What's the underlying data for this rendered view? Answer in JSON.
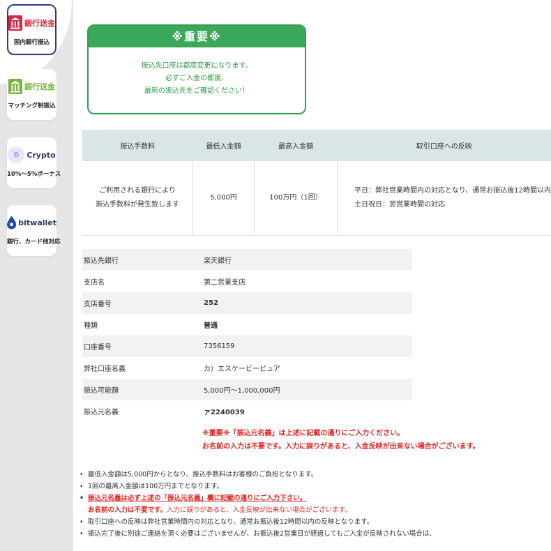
{
  "sidebar": {
    "tabs": [
      {
        "title": "銀行送金",
        "subtitle": "国内銀行振込",
        "active": true,
        "color": "#d7263d",
        "icon": "bank-icon"
      },
      {
        "title": "銀行送金",
        "subtitle": "マッチング制振込",
        "active": false,
        "color": "#7ab33d",
        "icon": "bank-icon"
      },
      {
        "title": "Crypto",
        "subtitle": "10%〜5%ボーナス",
        "active": false,
        "icon": "crypto-icon"
      },
      {
        "title": "bitwallet",
        "subtitle": "銀行、カード他対応",
        "active": false,
        "icon": "bitwallet-icon"
      }
    ]
  },
  "notice": {
    "title": "※重要※",
    "lines": [
      "振込先口座は都度変更になります。",
      "必ずご入金の都度、",
      "最新の振込先をご確認ください！"
    ]
  },
  "fee_table": {
    "headers": [
      "振込手数料",
      "最低入金額",
      "最高入金額",
      "取引口座への反映"
    ],
    "row": {
      "fee": [
        "ご利用される銀行により",
        "振込手数料が発生致します"
      ],
      "min": "5,000円",
      "max": "100万円（1回）",
      "reflect": [
        "平日：弊社営業時間内の対応となり、通常お振込後12時間以内",
        "土日祝日：翌営業時間の対応"
      ]
    }
  },
  "bank_info": [
    {
      "label": "振込先銀行",
      "value": "楽天銀行",
      "bold": false
    },
    {
      "label": "支店名",
      "value": "第二営業支店",
      "bold": false
    },
    {
      "label": "支店番号",
      "value": "252",
      "bold": true
    },
    {
      "label": "種類",
      "value": "普通",
      "bold": true
    },
    {
      "label": "口座番号",
      "value": "7356159",
      "bold": false
    },
    {
      "label": "弊社口座名義",
      "value": "カ）エスケービーピュア",
      "bold": false
    },
    {
      "label": "振込可能額",
      "value": "5,000円〜1,000,000円",
      "bold": false
    },
    {
      "label": "振込元名義",
      "value": "ァ2240039",
      "bold": true
    }
  ],
  "warning": [
    "※重要※「振込元名義」は上述に記載の通りにご入力ください。",
    "お名前の入力は不要です。入力に誤りがあると、入金反映が出来ない場合がございます。"
  ],
  "notes": {
    "n1": "最低入金額は5,000円からとなり、振込手数料はお客様のご負担となります。",
    "n2": "1回の最高入金額は100万円までとなります。",
    "n3a": "振込元名義は必ず上述の「振込元名義」欄に記載の通りにご入力下さい。",
    "n3b_bold": "お名前の入力は不要です。",
    "n3b_rest": "入力に誤りがあると、入金反映が出来ない場合がございます。",
    "n4": "取引口座への反映は弊社営業時間内の対応となり、通常お振込後12時間以内の反映となります。",
    "n5": "振込完了後に別途ご連絡を頂く必要はございませんが、お振込後2営業日が経過してもご入金が反映されない場合は、"
  }
}
